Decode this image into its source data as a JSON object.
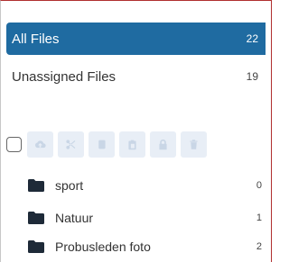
{
  "nav": {
    "all_files": {
      "label": "All Files",
      "count": "22"
    },
    "unassigned": {
      "label": "Unassigned Files",
      "count": "19"
    }
  },
  "toolbar": {
    "buttons": [
      "cloud-upload-icon",
      "scissors-icon",
      "copy-icon",
      "paste-icon",
      "lock-icon",
      "trash-icon"
    ]
  },
  "folders": [
    {
      "name": "sport",
      "count": "0"
    },
    {
      "name": "Natuur",
      "count": "1"
    },
    {
      "name": "Probusleden foto",
      "count": "2"
    }
  ],
  "colors": {
    "accent": "#1f6ba1",
    "folder_icon": "#1e2a38",
    "toolbar_button_bg": "#e8eef6"
  }
}
